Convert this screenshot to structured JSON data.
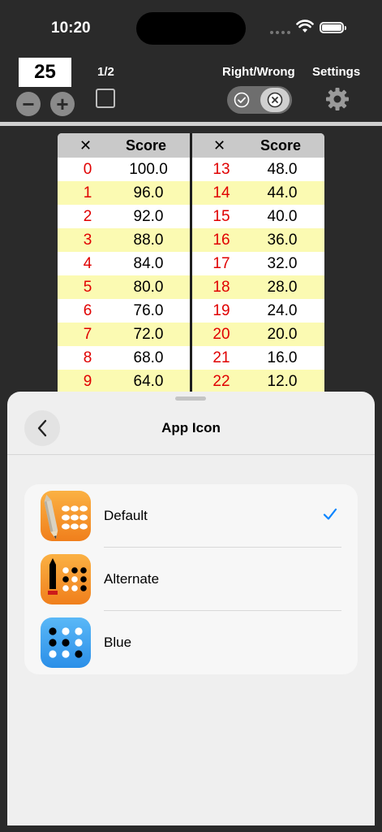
{
  "status_bar": {
    "time": "10:20"
  },
  "toolbar": {
    "count": "25",
    "minus_label": "−",
    "plus_label": "+",
    "page_label": "1/2",
    "right_wrong_label": "Right/Wrong",
    "settings_label": "Settings"
  },
  "score_table": {
    "headers": {
      "x_left": "✕",
      "score_left": "Score",
      "x_right": "✕",
      "score_right": "Score"
    },
    "left_rows": [
      {
        "x": "0",
        "score": "100.0"
      },
      {
        "x": "1",
        "score": "96.0"
      },
      {
        "x": "2",
        "score": "92.0"
      },
      {
        "x": "3",
        "score": "88.0"
      },
      {
        "x": "4",
        "score": "84.0"
      },
      {
        "x": "5",
        "score": "80.0"
      },
      {
        "x": "6",
        "score": "76.0"
      },
      {
        "x": "7",
        "score": "72.0"
      },
      {
        "x": "8",
        "score": "68.0"
      },
      {
        "x": "9",
        "score": "64.0"
      }
    ],
    "right_rows": [
      {
        "x": "13",
        "score": "48.0"
      },
      {
        "x": "14",
        "score": "44.0"
      },
      {
        "x": "15",
        "score": "40.0"
      },
      {
        "x": "16",
        "score": "36.0"
      },
      {
        "x": "17",
        "score": "32.0"
      },
      {
        "x": "18",
        "score": "28.0"
      },
      {
        "x": "19",
        "score": "24.0"
      },
      {
        "x": "20",
        "score": "20.0"
      },
      {
        "x": "21",
        "score": "16.0"
      },
      {
        "x": "22",
        "score": "12.0"
      }
    ]
  },
  "sheet": {
    "title": "App Icon",
    "icons": [
      {
        "label": "Default",
        "selected": true
      },
      {
        "label": "Alternate",
        "selected": false
      },
      {
        "label": "Blue",
        "selected": false
      }
    ]
  },
  "colors": {
    "accent": "#0a84ff",
    "wrong_red": "#e00000",
    "row_highlight": "#fbfab2",
    "orange_icon": "#f59a2a",
    "blue_icon": "#3aa0f0"
  }
}
